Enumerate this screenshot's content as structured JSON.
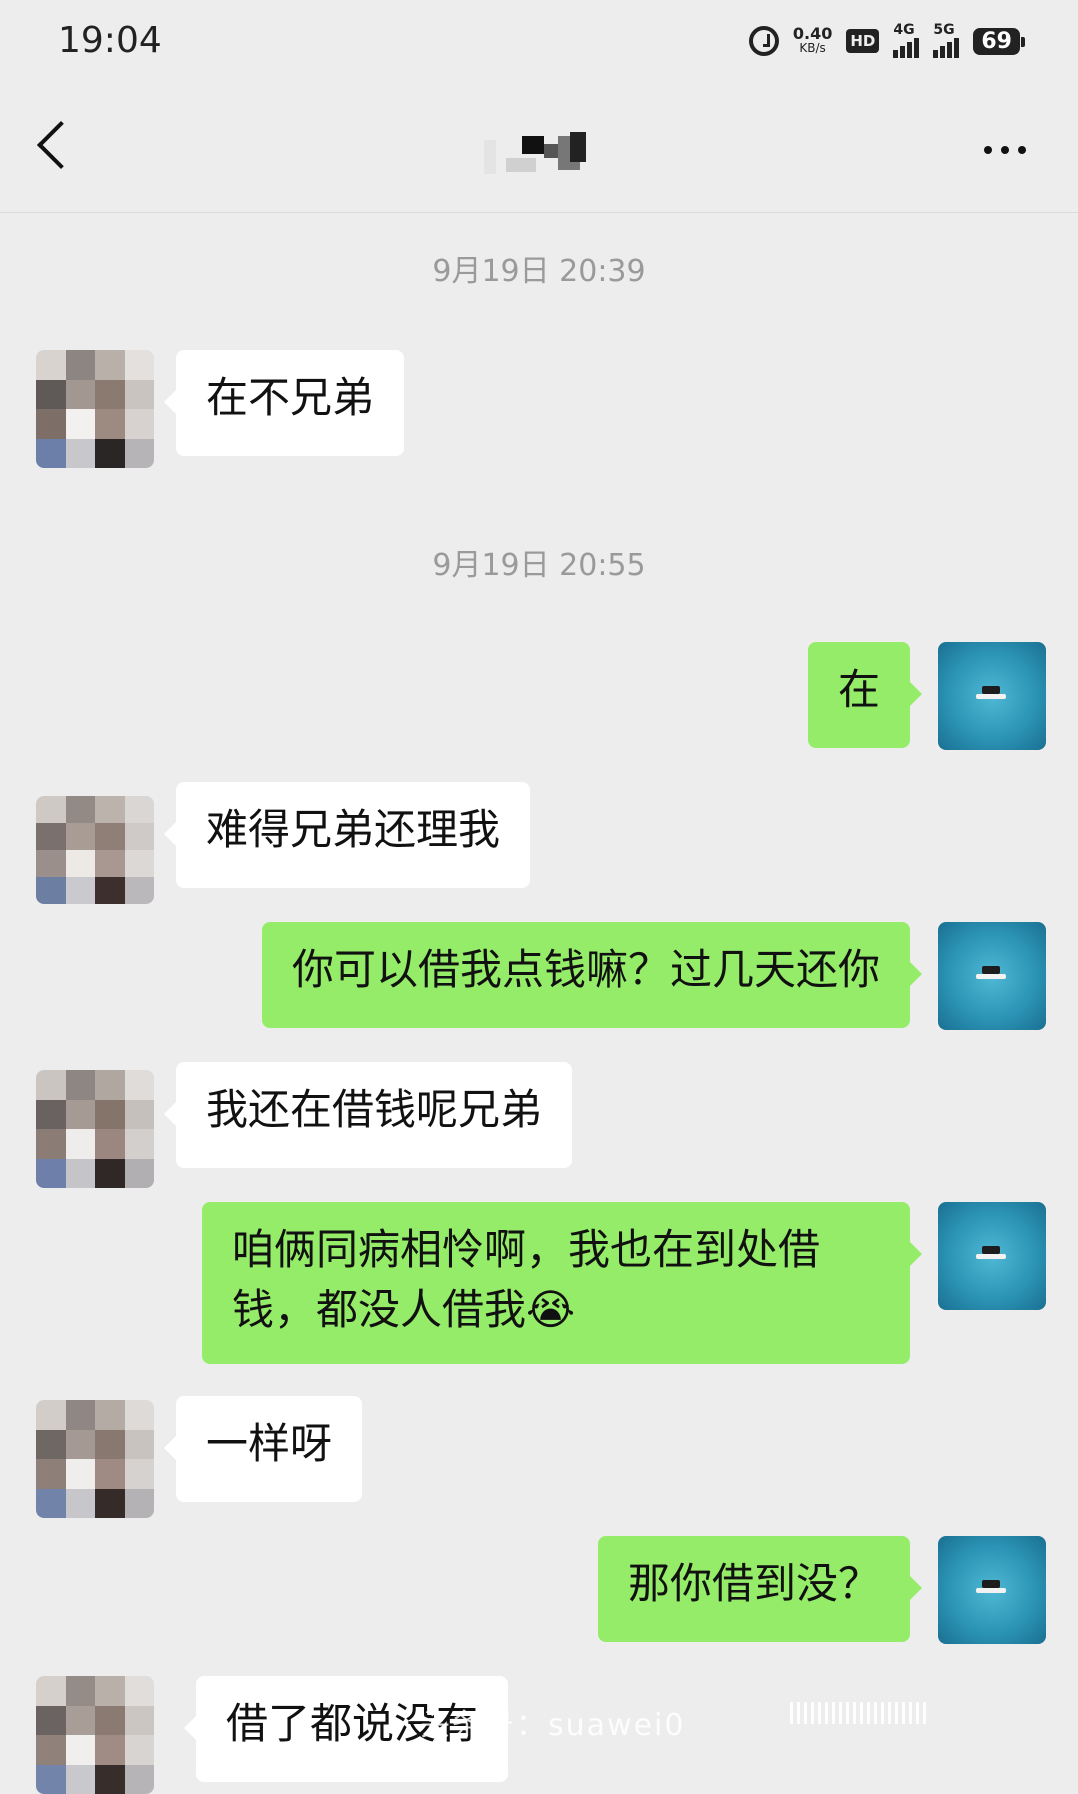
{
  "status_bar": {
    "time": "19:04",
    "net_speed_value": "0.40",
    "net_speed_unit": "KB/s",
    "hd_label": "HD",
    "sim1_label": "4G",
    "sim2_label": "5G",
    "battery": "69",
    "icons": [
      "alarm-icon",
      "hd-icon",
      "signal-icon",
      "battery-icon"
    ]
  },
  "nav": {
    "back_icon": "chevron-left-icon",
    "more_icon": "more-icon"
  },
  "timestamps": [
    "9月19日 20:39",
    "9月19日 20:55"
  ],
  "messages": [
    {
      "side": "in",
      "text": "在不兄弟"
    },
    {
      "side": "out",
      "text": "在"
    },
    {
      "side": "in",
      "text": "难得兄弟还理我"
    },
    {
      "side": "out",
      "text": "你可以借我点钱嘛？过几天还你"
    },
    {
      "side": "in",
      "text": "我还在借钱呢兄弟"
    },
    {
      "side": "out",
      "text": "咱俩同病相怜啊，我也在到处借钱，都没人借我😭"
    },
    {
      "side": "in",
      "text": "一样呀"
    },
    {
      "side": "out",
      "text": "那你借到没？"
    },
    {
      "side": "in",
      "text": "借了都说没有"
    }
  ],
  "watermark": "头条号：suawei0"
}
